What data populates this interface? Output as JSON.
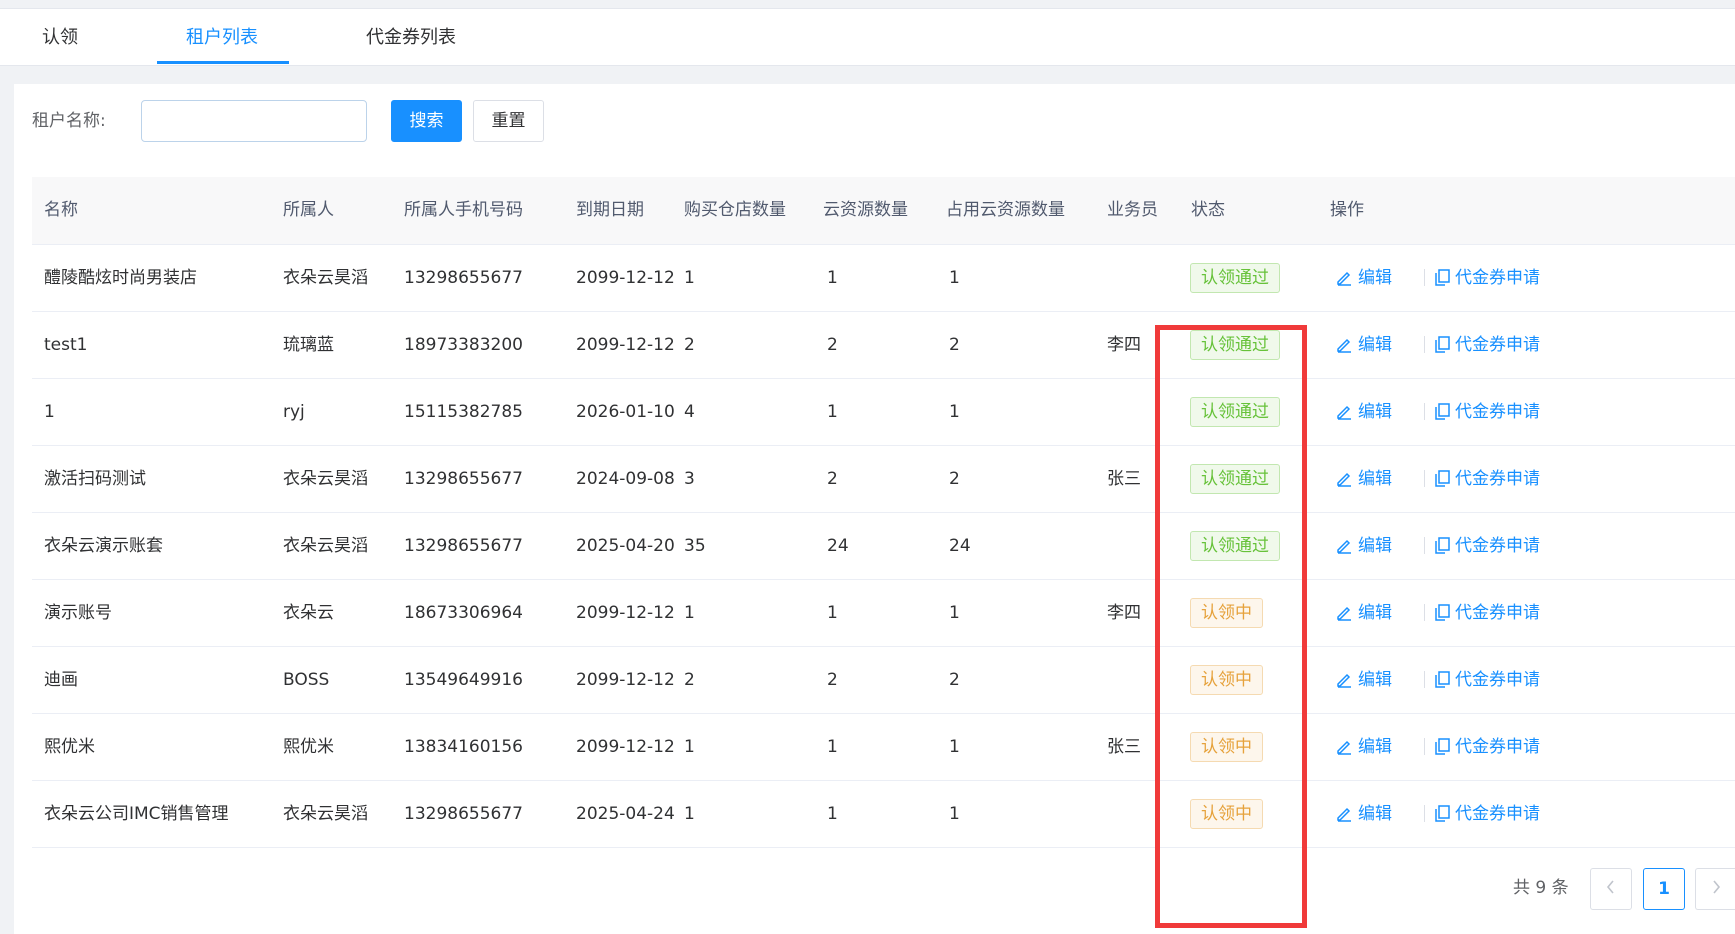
{
  "tabs": [
    {
      "label": "认领"
    },
    {
      "label": "租户列表"
    },
    {
      "label": "代金券列表"
    }
  ],
  "search": {
    "label": "租户名称:",
    "value": "",
    "search_button": "搜索",
    "reset_button": "重置"
  },
  "table": {
    "columns": [
      "名称",
      "所属人",
      "所属人手机号码",
      "到期日期",
      "购买仓店数量",
      "云资源数量",
      "占用云资源数量",
      "业务员",
      "状态",
      "操作"
    ],
    "rows": [
      {
        "name": "醴陵酷炫时尚男装店",
        "owner": "衣朵云昊滔",
        "phone": "13298655677",
        "expire": "2099-12-12",
        "stores": "1",
        "cloud": "1",
        "used_cloud": "1",
        "salesman": "",
        "status": "认领通过",
        "status_type": "success"
      },
      {
        "name": "test1",
        "owner": "琉璃蓝",
        "phone": "18973383200",
        "expire": "2099-12-12",
        "stores": "2",
        "cloud": "2",
        "used_cloud": "2",
        "salesman": "李四",
        "status": "认领通过",
        "status_type": "success"
      },
      {
        "name": "1",
        "owner": "ryj",
        "phone": "15115382785",
        "expire": "2026-01-10",
        "stores": "4",
        "cloud": "1",
        "used_cloud": "1",
        "salesman": "",
        "status": "认领通过",
        "status_type": "success"
      },
      {
        "name": "激活扫码测试",
        "owner": "衣朵云昊滔",
        "phone": "13298655677",
        "expire": "2024-09-08",
        "stores": "3",
        "cloud": "2",
        "used_cloud": "2",
        "salesman": "张三",
        "status": "认领通过",
        "status_type": "success"
      },
      {
        "name": "衣朵云演示账套",
        "owner": "衣朵云昊滔",
        "phone": "13298655677",
        "expire": "2025-04-20",
        "stores": "35",
        "cloud": "24",
        "used_cloud": "24",
        "salesman": "",
        "status": "认领通过",
        "status_type": "success"
      },
      {
        "name": "演示账号",
        "owner": "衣朵云",
        "phone": "18673306964",
        "expire": "2099-12-12",
        "stores": "1",
        "cloud": "1",
        "used_cloud": "1",
        "salesman": "李四",
        "status": "认领中",
        "status_type": "warning"
      },
      {
        "name": "迪画",
        "owner": "BOSS",
        "phone": "13549649916",
        "expire": "2099-12-12",
        "stores": "2",
        "cloud": "2",
        "used_cloud": "2",
        "salesman": "",
        "status": "认领中",
        "status_type": "warning"
      },
      {
        "name": "熙优米",
        "owner": "熙优米",
        "phone": "13834160156",
        "expire": "2099-12-12",
        "stores": "1",
        "cloud": "1",
        "used_cloud": "1",
        "salesman": "张三",
        "status": "认领中",
        "status_type": "warning"
      },
      {
        "name": "衣朵云公司IMC销售管理",
        "owner": "衣朵云昊滔",
        "phone": "13298655677",
        "expire": "2025-04-24",
        "stores": "1",
        "cloud": "1",
        "used_cloud": "1",
        "salesman": "",
        "status": "认领中",
        "status_type": "warning"
      }
    ],
    "actions": {
      "edit": "编辑",
      "voucher": "代金券申请"
    }
  },
  "pagination": {
    "total_text": "共 9 条",
    "current_page": "1",
    "prev_icon": "chevron-left-icon",
    "next_icon": "chevron-right-icon"
  },
  "colors": {
    "accent": "#1890ff",
    "success": "#67c23a",
    "warning": "#e6a23c",
    "highlight_box": "#f03a3a"
  }
}
